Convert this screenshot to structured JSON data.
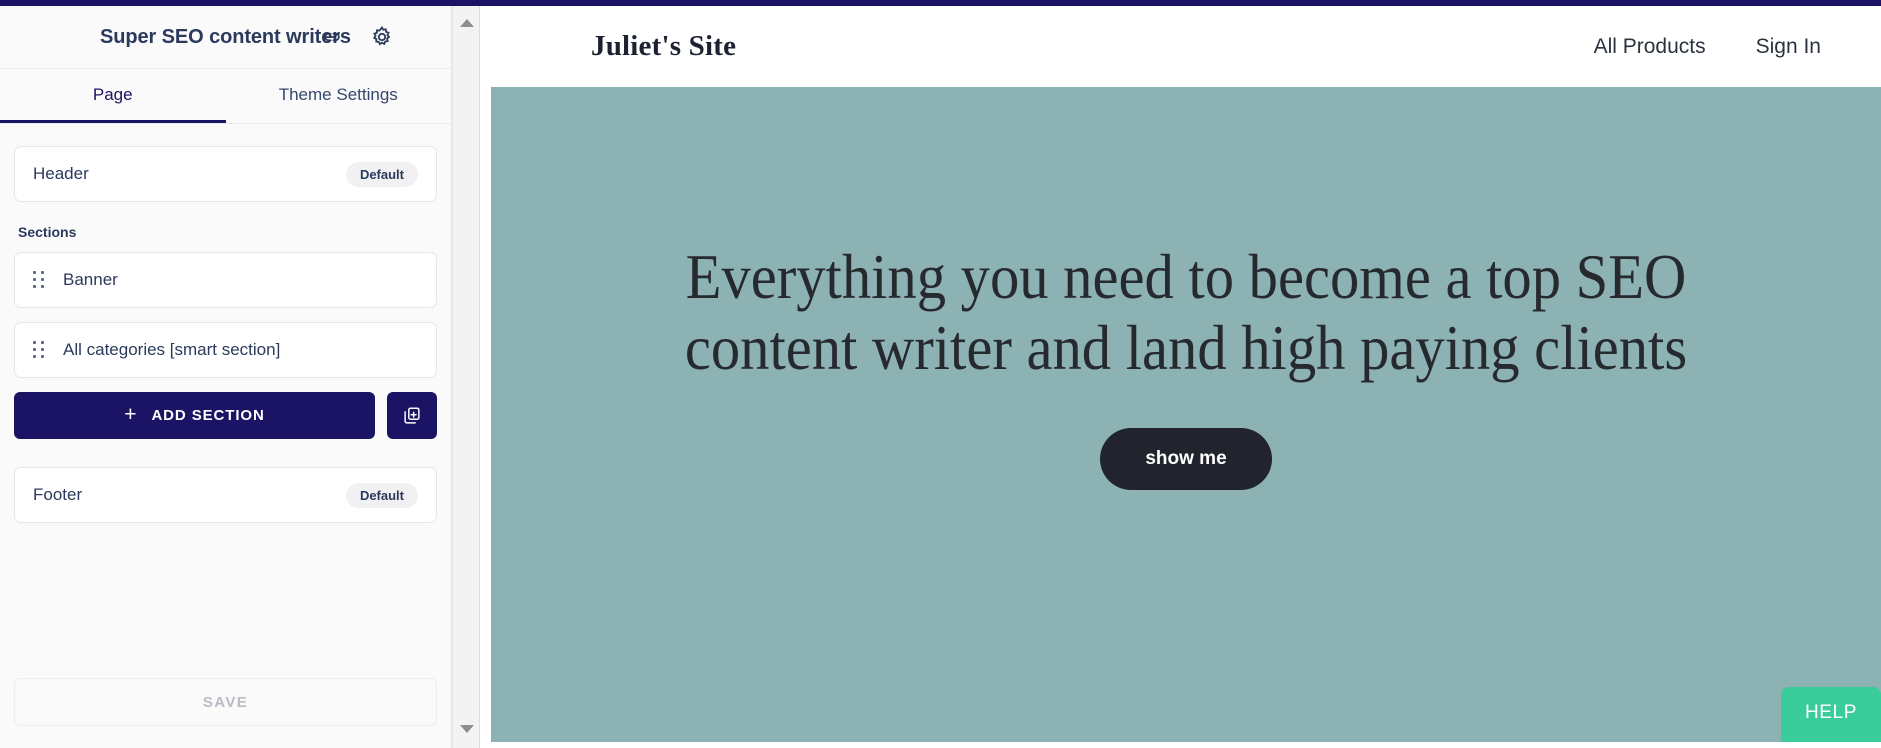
{
  "theme": {
    "navy": "#1b1464",
    "banner_teal": "#8cb2b3",
    "help_green": "#3acc9a",
    "cta_dark": "#21242c"
  },
  "editor": {
    "title": "Super SEO content writers",
    "icons": {
      "link": "link-icon",
      "gear": "gear-icon"
    },
    "tabs": [
      {
        "label": "Page",
        "active": true
      },
      {
        "label": "Theme Settings",
        "active": false
      }
    ],
    "header_section": {
      "label": "Header",
      "badge": "Default"
    },
    "sections_group_label": "Sections",
    "sections": [
      {
        "label": "Banner"
      },
      {
        "label": "All categories [smart section]"
      }
    ],
    "add_section_label": "ADD SECTION",
    "add_section_plus": "+",
    "duplicate_icon": "duplicate-section-icon",
    "footer_section": {
      "label": "Footer",
      "badge": "Default"
    },
    "save_label": "SAVE",
    "scrollbar": {
      "up_icon": "scroll-up-arrow-icon",
      "down_icon": "scroll-down-arrow-icon"
    }
  },
  "preview": {
    "site_name": "Juliet's Site",
    "nav_links": [
      {
        "label": "All Products"
      },
      {
        "label": "Sign In"
      }
    ],
    "hero": {
      "heading": "Everything you need to become a top SEO content writer and land high paying clients",
      "cta_label": "show me"
    },
    "help_label": "HELP"
  }
}
